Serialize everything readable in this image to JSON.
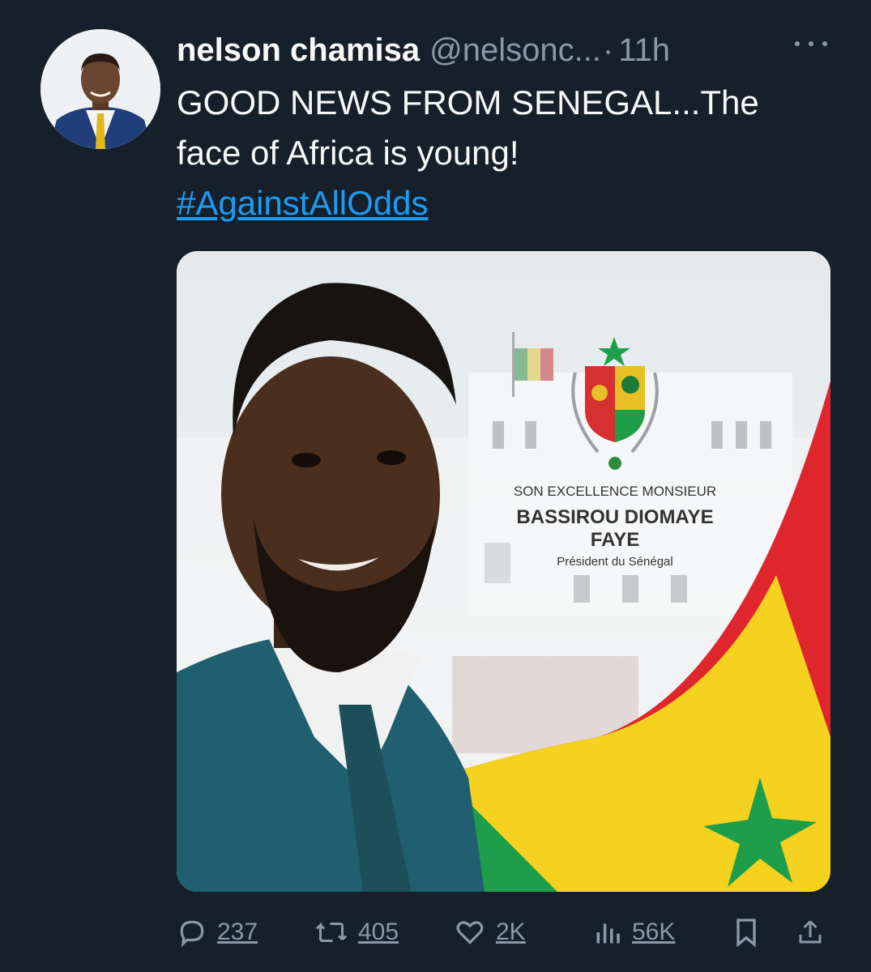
{
  "tweet": {
    "author_name": "nelson chamisa",
    "author_handle": "@nelsonc...",
    "separator": "·",
    "time": "11h",
    "text_line1": "GOOD NEWS FROM SENEGAL...The",
    "text_line2": "face of Africa is young!",
    "hashtag": "#AgainstAllOdds"
  },
  "media": {
    "caption_line1": "SON EXCELLENCE MONSIEUR",
    "caption_line2": "BASSIROU DIOMAYE",
    "caption_line3": "FAYE",
    "caption_line4": "Président du Sénégal",
    "flag_colors": [
      "#1e9e4a",
      "#f4d21f",
      "#e0262d"
    ]
  },
  "actions": {
    "replies": "237",
    "retweets": "405",
    "likes": "2K",
    "views": "56K"
  },
  "colors": {
    "background": "#15202b",
    "text_primary": "#f7f9f9",
    "text_secondary": "#8b98a5",
    "link": "#1d9bf0"
  },
  "icons": {
    "more": "more-dots-icon",
    "reply": "reply-icon",
    "retweet": "retweet-icon",
    "like": "heart-icon",
    "views": "views-bar-chart-icon",
    "bookmark": "bookmark-icon",
    "share": "share-icon"
  }
}
